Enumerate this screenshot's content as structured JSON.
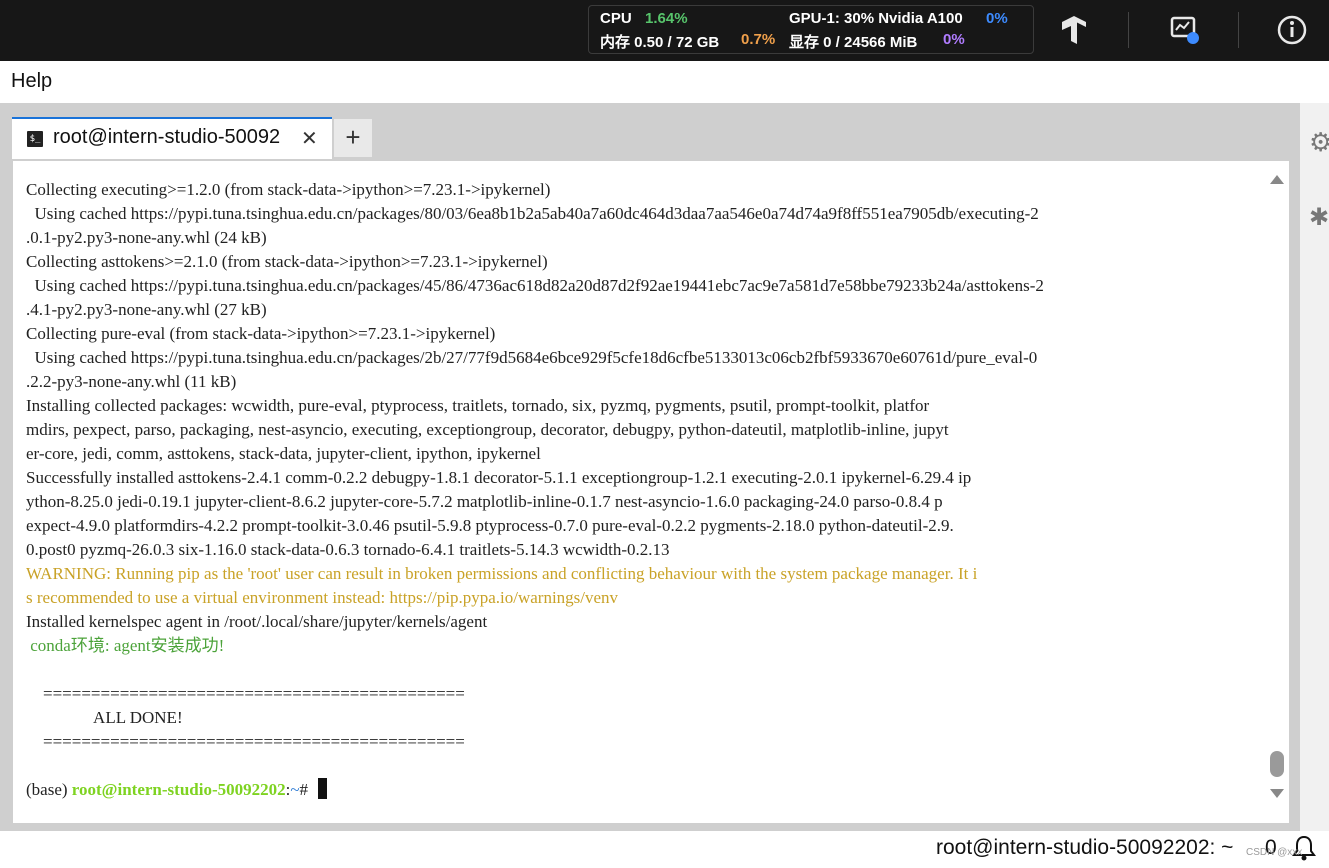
{
  "topbar": {
    "cpu_label": "CPU",
    "cpu_value": "1.64%",
    "mem_label": "内存 0.50 / 72 GB",
    "mem_pct": "0.7%",
    "gpu_label": "GPU-1: 30% Nvidia A100",
    "gpu_pct": "0%",
    "vram_label": "显存 0 / 24566 MiB",
    "vram_pct": "0%"
  },
  "menu": {
    "help": "Help"
  },
  "tab": {
    "title": "root@intern-studio-50092",
    "close": "✕",
    "add": "+",
    "icon_text": "$_"
  },
  "terminal": {
    "lines": [
      "Collecting executing>=1.2.0 (from stack-data->ipython>=7.23.1->ipykernel)",
      "  Using cached https://pypi.tuna.tsinghua.edu.cn/packages/80/03/6ea8b1b2a5ab40a7a60dc464d3daa7aa546e0a74d74a9f8ff551ea7905db/executing-2",
      ".0.1-py2.py3-none-any.whl (24 kB)",
      "Collecting asttokens>=2.1.0 (from stack-data->ipython>=7.23.1->ipykernel)",
      "  Using cached https://pypi.tuna.tsinghua.edu.cn/packages/45/86/4736ac618d82a20d87d2f92ae19441ebc7ac9e7a581d7e58bbe79233b24a/asttokens-2",
      ".4.1-py2.py3-none-any.whl (27 kB)",
      "Collecting pure-eval (from stack-data->ipython>=7.23.1->ipykernel)",
      "  Using cached https://pypi.tuna.tsinghua.edu.cn/packages/2b/27/77f9d5684e6bce929f5cfe18d6cfbe5133013c06cb2fbf5933670e60761d/pure_eval-0",
      ".2.2-py3-none-any.whl (11 kB)",
      "Installing collected packages: wcwidth, pure-eval, ptyprocess, traitlets, tornado, six, pyzmq, pygments, psutil, prompt-toolkit, platfor",
      "mdirs, pexpect, parso, packaging, nest-asyncio, executing, exceptiongroup, decorator, debugpy, python-dateutil, matplotlib-inline, jupyt",
      "er-core, jedi, comm, asttokens, stack-data, jupyter-client, ipython, ipykernel",
      "Successfully installed asttokens-2.4.1 comm-0.2.2 debugpy-1.8.1 decorator-5.1.1 exceptiongroup-1.2.1 executing-2.0.1 ipykernel-6.29.4 ip",
      "ython-8.25.0 jedi-0.19.1 jupyter-client-8.6.2 jupyter-core-5.7.2 matplotlib-inline-0.1.7 nest-asyncio-1.6.0 packaging-24.0 parso-0.8.4 p",
      "expect-4.9.0 platformdirs-4.2.2 prompt-toolkit-3.0.46 psutil-5.9.8 ptyprocess-0.7.0 pure-eval-0.2.2 pygments-2.18.0 python-dateutil-2.9.",
      "0.post0 pyzmq-26.0.3 six-1.16.0 stack-data-0.6.3 tornado-6.4.1 traitlets-5.14.3 wcwidth-0.2.13"
    ],
    "warning_lines": [
      "WARNING: Running pip as the 'root' user can result in broken permissions and conflicting behaviour with the system package manager. It i",
      "s recommended to use a virtual environment instead: https://pip.pypa.io/warnings/venv"
    ],
    "kernelspec_line": "Installed kernelspec agent in /root/.local/share/jupyter/kernels/agent",
    "conda_line": " conda环境: agent安装成功!",
    "separator": "    ============================================",
    "all_done": "                ALL DONE!",
    "prompt_env": "(base) ",
    "prompt_user": "root@intern-studio-50092202",
    "prompt_colon": ":",
    "prompt_path": "~",
    "prompt_hash": "# "
  },
  "statusbar": {
    "text": "root@intern-studio-50092202: ~",
    "count": "0",
    "watermark": "CSDN @xxx"
  },
  "colors": {
    "accent": "#1a73d9",
    "warning": "#c9a227",
    "conda": "#4ca33a",
    "prompt_user": "#7ed321"
  }
}
